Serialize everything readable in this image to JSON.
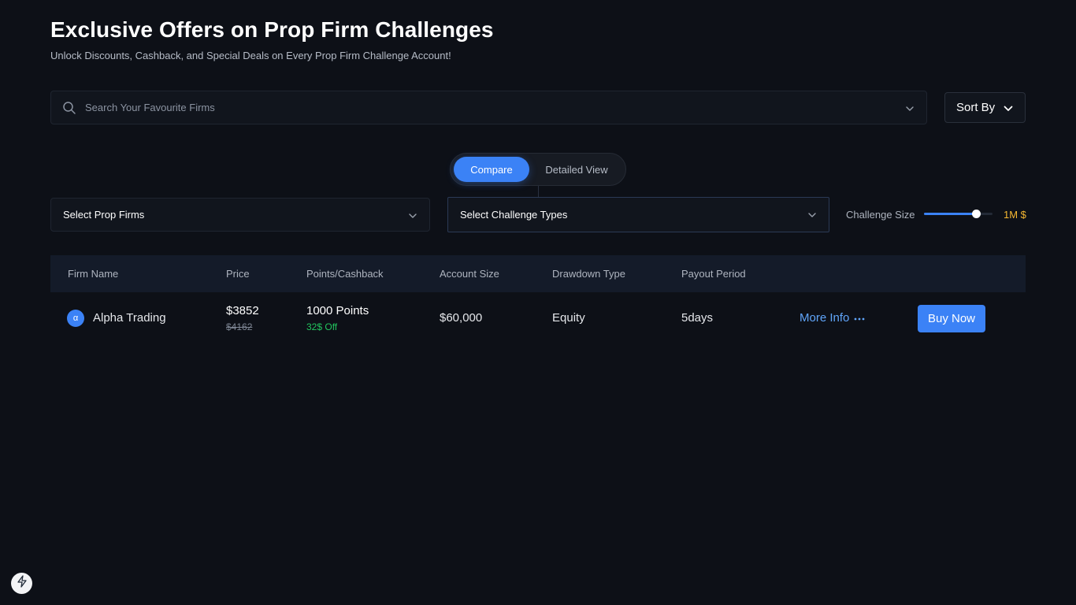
{
  "header": {
    "title": "Exclusive Offers on Prop Firm Challenges",
    "subtitle": "Unlock Discounts, Cashback, and Special Deals on Every Prop Firm Challenge Account!"
  },
  "search": {
    "placeholder": "Search Your Favourite Firms",
    "value": ""
  },
  "sort": {
    "label": "Sort By"
  },
  "view_toggle": {
    "options": [
      "Compare",
      "Detailed View"
    ],
    "selected": "Compare"
  },
  "filters": {
    "prop_firms_label": "Select Prop Firms",
    "challenge_types_label": "Select Challenge Types",
    "challenge_size_label": "Challenge Size",
    "challenge_size_value": "1M $",
    "challenge_size_fraction": 0.76
  },
  "table": {
    "columns": [
      "Firm Name",
      "Price",
      "Points/Cashback",
      "Account Size",
      "Drawdown Type",
      "Payout Period"
    ],
    "rows": [
      {
        "logo_glyph": "α",
        "firm_name": "Alpha Trading",
        "price": "$3852",
        "original_price": "$4162",
        "points": "1000 Points",
        "discount": "32$ Off",
        "account_size": "$60,000",
        "drawdown_type": "Equity",
        "payout_period": "5days",
        "more_info_label": "More Info",
        "buy_label": "Buy Now"
      }
    ]
  },
  "icons": {
    "search": "search-icon",
    "chevron": "chevron-down-icon",
    "more": "more-horizontal-icon",
    "bolt": "lightning-bolt-icon"
  },
  "colors": {
    "background": "#0d1017",
    "accent": "#3b82f6",
    "discount": "#22c55e",
    "size_value": "#f5b731",
    "link": "#60a5fa"
  }
}
